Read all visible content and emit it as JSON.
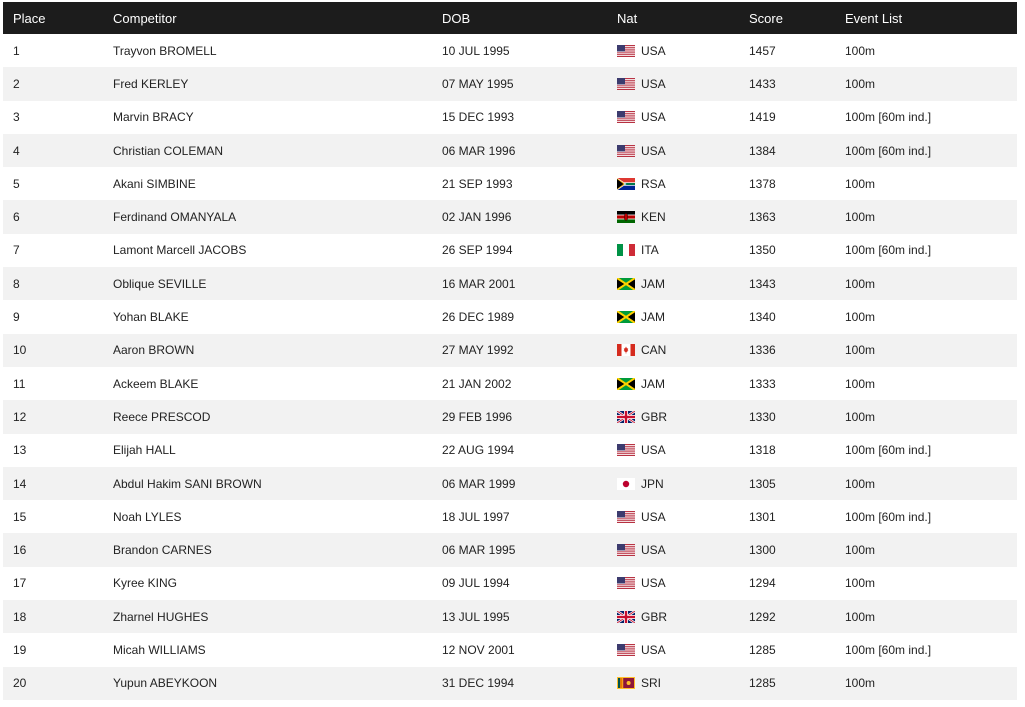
{
  "headers": {
    "place": "Place",
    "competitor": "Competitor",
    "dob": "DOB",
    "nat": "Nat",
    "score": "Score",
    "events": "Event List"
  },
  "rows": [
    {
      "place": "1",
      "competitor": "Trayvon BROMELL",
      "dob": "10 JUL 1995",
      "nat": "USA",
      "score": "1457",
      "events": "100m"
    },
    {
      "place": "2",
      "competitor": "Fred KERLEY",
      "dob": "07 MAY 1995",
      "nat": "USA",
      "score": "1433",
      "events": "100m"
    },
    {
      "place": "3",
      "competitor": "Marvin BRACY",
      "dob": "15 DEC 1993",
      "nat": "USA",
      "score": "1419",
      "events": "100m [60m ind.]"
    },
    {
      "place": "4",
      "competitor": "Christian COLEMAN",
      "dob": "06 MAR 1996",
      "nat": "USA",
      "score": "1384",
      "events": "100m [60m ind.]"
    },
    {
      "place": "5",
      "competitor": "Akani SIMBINE",
      "dob": "21 SEP 1993",
      "nat": "RSA",
      "score": "1378",
      "events": "100m"
    },
    {
      "place": "6",
      "competitor": "Ferdinand OMANYALA",
      "dob": "02 JAN 1996",
      "nat": "KEN",
      "score": "1363",
      "events": "100m"
    },
    {
      "place": "7",
      "competitor": "Lamont Marcell JACOBS",
      "dob": "26 SEP 1994",
      "nat": "ITA",
      "score": "1350",
      "events": "100m [60m ind.]"
    },
    {
      "place": "8",
      "competitor": "Oblique SEVILLE",
      "dob": "16 MAR 2001",
      "nat": "JAM",
      "score": "1343",
      "events": "100m"
    },
    {
      "place": "9",
      "competitor": "Yohan BLAKE",
      "dob": "26 DEC 1989",
      "nat": "JAM",
      "score": "1340",
      "events": "100m"
    },
    {
      "place": "10",
      "competitor": "Aaron BROWN",
      "dob": "27 MAY 1992",
      "nat": "CAN",
      "score": "1336",
      "events": "100m"
    },
    {
      "place": "11",
      "competitor": "Ackeem BLAKE",
      "dob": "21 JAN 2002",
      "nat": "JAM",
      "score": "1333",
      "events": "100m"
    },
    {
      "place": "12",
      "competitor": "Reece PRESCOD",
      "dob": "29 FEB 1996",
      "nat": "GBR",
      "score": "1330",
      "events": "100m"
    },
    {
      "place": "13",
      "competitor": "Elijah HALL",
      "dob": "22 AUG 1994",
      "nat": "USA",
      "score": "1318",
      "events": "100m [60m ind.]"
    },
    {
      "place": "14",
      "competitor": "Abdul Hakim SANI BROWN",
      "dob": "06 MAR 1999",
      "nat": "JPN",
      "score": "1305",
      "events": "100m"
    },
    {
      "place": "15",
      "competitor": "Noah LYLES",
      "dob": "18 JUL 1997",
      "nat": "USA",
      "score": "1301",
      "events": "100m [60m ind.]"
    },
    {
      "place": "16",
      "competitor": "Brandon CARNES",
      "dob": "06 MAR 1995",
      "nat": "USA",
      "score": "1300",
      "events": "100m"
    },
    {
      "place": "17",
      "competitor": "Kyree KING",
      "dob": "09 JUL 1994",
      "nat": "USA",
      "score": "1294",
      "events": "100m"
    },
    {
      "place": "18",
      "competitor": "Zharnel HUGHES",
      "dob": "13 JUL 1995",
      "nat": "GBR",
      "score": "1292",
      "events": "100m"
    },
    {
      "place": "19",
      "competitor": "Micah WILLIAMS",
      "dob": "12 NOV 2001",
      "nat": "USA",
      "score": "1285",
      "events": "100m [60m ind.]"
    },
    {
      "place": "20",
      "competitor": "Yupun ABEYKOON",
      "dob": "31 DEC 1994",
      "nat": "SRI",
      "score": "1285",
      "events": "100m"
    }
  ],
  "colors": {
    "header_bg": "#1c1c1c",
    "header_text": "#ffffff",
    "row_alt_bg": "#f2f2f2",
    "text": "#222222"
  },
  "flag_icons": {
    "USA": "usa-flag-icon",
    "RSA": "rsa-flag-icon",
    "KEN": "ken-flag-icon",
    "ITA": "ita-flag-icon",
    "JAM": "jam-flag-icon",
    "CAN": "can-flag-icon",
    "GBR": "gbr-flag-icon",
    "JPN": "jpn-flag-icon",
    "SRI": "sri-flag-icon"
  }
}
